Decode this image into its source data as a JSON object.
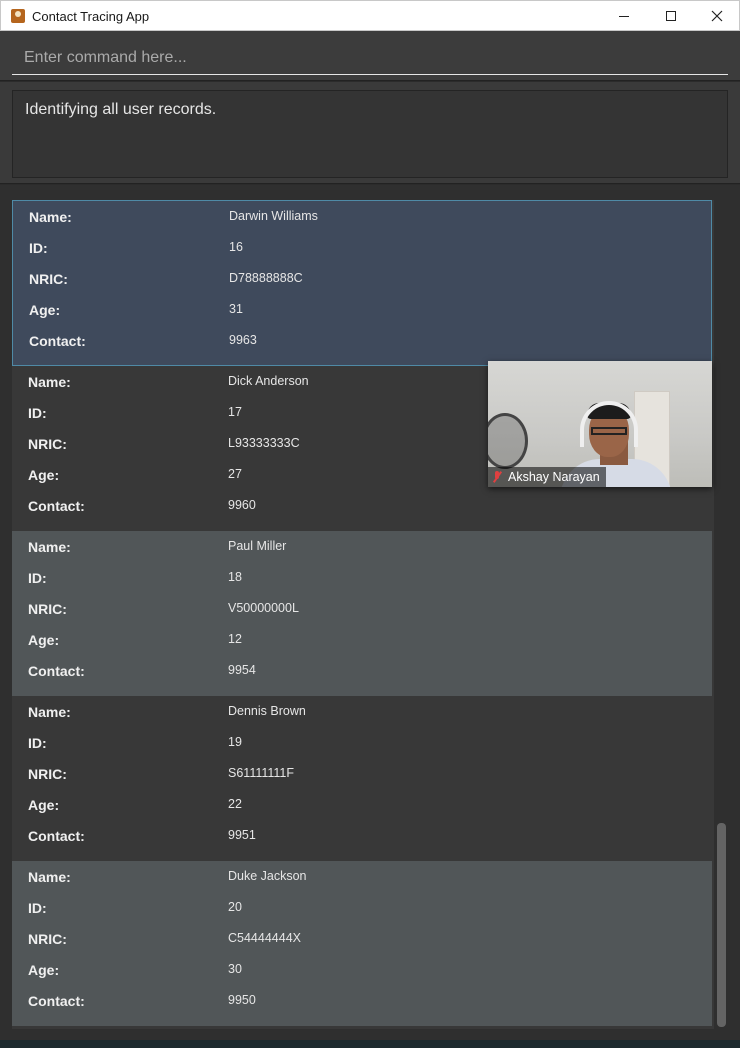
{
  "window": {
    "title": "Contact Tracing App",
    "controls": {
      "minimize": "minimize-icon",
      "maximize": "maximize-icon",
      "close": "close-icon"
    }
  },
  "command": {
    "placeholder": "Enter command here...",
    "value": ""
  },
  "result": {
    "text": "Identifying all user records."
  },
  "labels": {
    "name": "Name:",
    "id": "ID:",
    "nric": "NRIC:",
    "age": "Age:",
    "contact": "Contact:"
  },
  "persons": [
    {
      "name": "Darwin Williams",
      "id": "16",
      "nric": "D78888888C",
      "age": "31",
      "contact": "9963"
    },
    {
      "name": "Dick Anderson",
      "id": "17",
      "nric": "L93333333C",
      "age": "27",
      "contact": "9960"
    },
    {
      "name": "Paul Miller",
      "id": "18",
      "nric": "V50000000L",
      "age": "12",
      "contact": "9954"
    },
    {
      "name": "Dennis Brown",
      "id": "19",
      "nric": "S61111111F",
      "age": "22",
      "contact": "9951"
    },
    {
      "name": "Duke Jackson",
      "id": "20",
      "nric": "C54444444X",
      "age": "30",
      "contact": "9950"
    }
  ],
  "video": {
    "participant": "Akshay Narayan",
    "mic_icon": "muted-mic-icon"
  }
}
